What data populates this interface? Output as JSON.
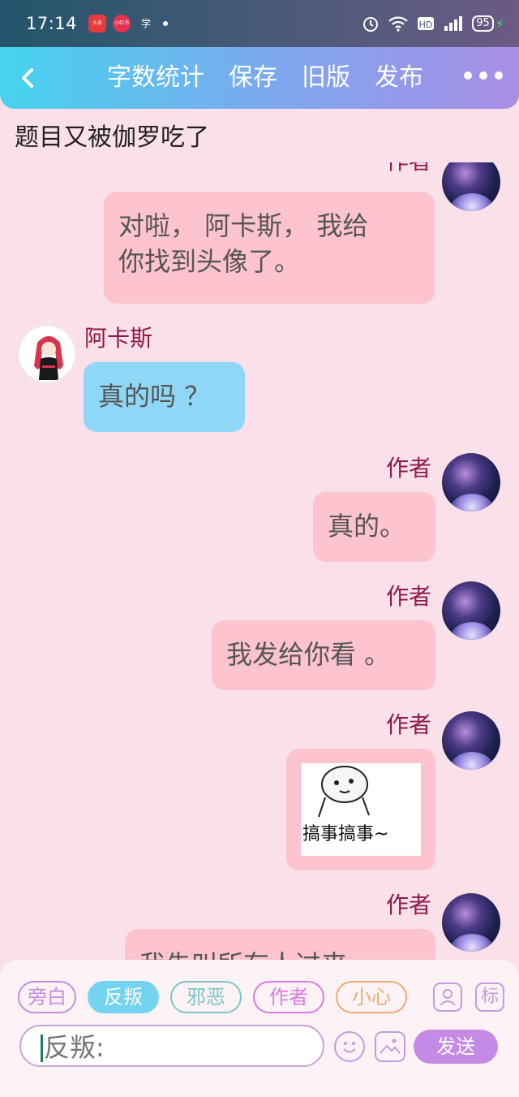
{
  "status_bar": {
    "time": "17:14",
    "notifications": [
      {
        "label": "头条",
        "color": "#e53b3b"
      },
      {
        "label": "小红书",
        "color": "#e8304f"
      },
      {
        "label": "学习",
        "color": "#ffffff"
      }
    ],
    "battery": "95"
  },
  "app_bar": {
    "actions": [
      "字数统计",
      "保存",
      "旧版",
      "发布"
    ]
  },
  "doc_title": "题目又被伽罗吃了",
  "messages": [
    {
      "speaker": "作者",
      "side": "right",
      "text": "对啦， 阿卡斯， 我给\n你找到头像了。"
    },
    {
      "speaker": "阿卡斯",
      "side": "left",
      "text": "真的吗 ？"
    },
    {
      "speaker": "作者",
      "side": "right",
      "text": "真的。"
    },
    {
      "speaker": "作者",
      "side": "right",
      "text": "我发给你看 。"
    },
    {
      "speaker": "作者",
      "side": "right",
      "image_caption": "搞事搞事~"
    },
    {
      "speaker": "作者",
      "side": "right",
      "text": "我先叫所有人过来"
    }
  ],
  "role_tags": [
    "旁白",
    "反叛",
    "邪恶",
    "作者",
    "小心"
  ],
  "selected_tag": "反叛",
  "tool_icons": {
    "person": "person-card-icon",
    "mark": "标"
  },
  "input": {
    "value": "反叛:"
  },
  "send_label": "发送",
  "colors": {
    "speaker_name": "#8b1a4b",
    "author_bubble": "#fdc3cf",
    "reply_bubble": "#8fd7f7",
    "send_button": "#c48ae6"
  }
}
